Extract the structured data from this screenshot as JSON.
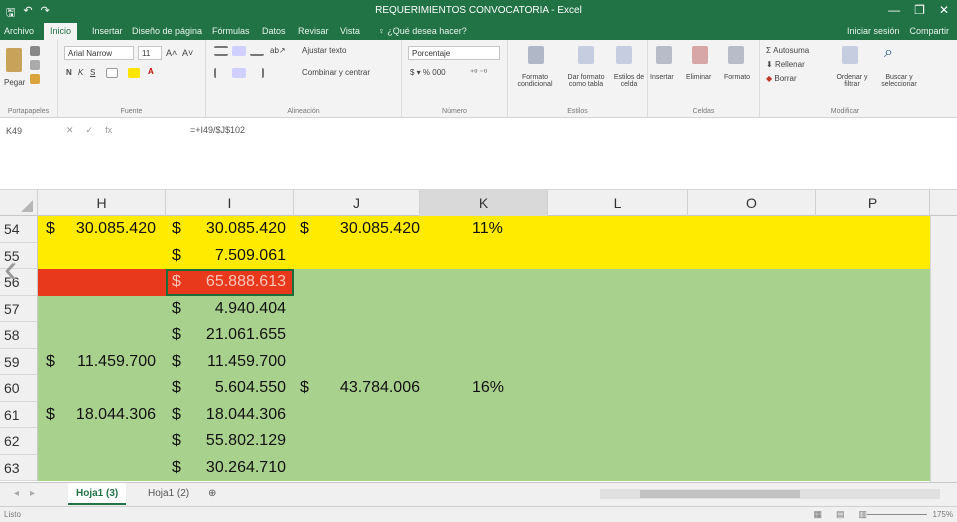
{
  "window": {
    "title": "REQUERIMIENTOS CONVOCATORIA - Excel",
    "minimize": "—",
    "restore": "❐",
    "close": "✕"
  },
  "ribbon_tabs": [
    "Archivo",
    "Inicio",
    "Insertar",
    "Diseño de página",
    "Fórmulas",
    "Datos",
    "Revisar",
    "Vista",
    "♀ ¿Qué desea hacer?"
  ],
  "ribbon_right": {
    "signin": "Iniciar sesión",
    "share": "Compartir"
  },
  "ribbon": {
    "clipboard": {
      "paste": "Pegar",
      "label": "Portapapeles"
    },
    "font": {
      "name": "Arial Narrow",
      "size": "11",
      "bold": "N",
      "italic": "K",
      "underline": "S",
      "label": "Fuente"
    },
    "alignment": {
      "wrap": "Ajustar texto",
      "merge": "Combinar y centrar",
      "label": "Alineación"
    },
    "number": {
      "format": "Porcentaje",
      "label": "Número"
    },
    "styles": {
      "conditional": "Formato condicional",
      "table": "Dar formato como tabla",
      "cell": "Estilos de celda",
      "label": "Estilos"
    },
    "cells": {
      "insert": "Insertar",
      "delete": "Eliminar",
      "format": "Formato",
      "label": "Celdas"
    },
    "editing": {
      "autosum": "Autosuma",
      "fill": "Rellenar",
      "clear": "Borrar",
      "sort": "Ordenar y filtrar",
      "find": "Buscar y seleccionar",
      "label": "Modificar"
    }
  },
  "formula_bar": {
    "name_box": "K49",
    "formula": "=+I49/$J$102"
  },
  "columns": [
    "H",
    "I",
    "J",
    "K",
    "L",
    "O",
    "P"
  ],
  "rows": [
    {
      "num": "54",
      "h_sym": "$",
      "h": "30.085.420",
      "i_sym": "$",
      "i": "30.085.420",
      "j_sym": "$",
      "j": "30.085.420",
      "k": "11%"
    },
    {
      "num": "55",
      "h_sym": "",
      "h": "",
      "i_sym": "$",
      "i": "7.509.061",
      "j_sym": "",
      "j": "",
      "k": ""
    },
    {
      "num": "56",
      "h_sym": "",
      "h": "",
      "i_sym": "$",
      "i": "65.888.613",
      "j_sym": "",
      "j": "",
      "k": ""
    },
    {
      "num": "57",
      "h_sym": "",
      "h": "",
      "i_sym": "$",
      "i": "4.940.404",
      "j_sym": "",
      "j": "",
      "k": ""
    },
    {
      "num": "58",
      "h_sym": "",
      "h": "",
      "i_sym": "$",
      "i": "21.061.655",
      "j_sym": "",
      "j": "",
      "k": ""
    },
    {
      "num": "59",
      "h_sym": "$",
      "h": "11.459.700",
      "i_sym": "$",
      "i": "11.459.700",
      "j_sym": "",
      "j": "",
      "k": ""
    },
    {
      "num": "60",
      "h_sym": "",
      "h": "",
      "i_sym": "$",
      "i": "5.604.550",
      "j_sym": "$",
      "j": "43.784.006",
      "k": "16%"
    },
    {
      "num": "61",
      "h_sym": "$",
      "h": "18.044.306",
      "i_sym": "$",
      "i": "18.044.306",
      "j_sym": "",
      "j": "",
      "k": ""
    },
    {
      "num": "62",
      "h_sym": "",
      "h": "",
      "i_sym": "$",
      "i": "55.802.129",
      "j_sym": "",
      "j": "",
      "k": ""
    },
    {
      "num": "63",
      "h_sym": "",
      "h": "",
      "i_sym": "$",
      "i": "30.264.710",
      "j_sym": "",
      "j": "",
      "k": ""
    }
  ],
  "sheet_tabs": [
    "Hoja1 (3)",
    "Hoja1 (2)"
  ],
  "add_sheet": "⊕",
  "status": {
    "ready": "Listo",
    "zoom": "175%"
  },
  "colors": {
    "excel_green": "#217346",
    "fill_yellow": "#ffeb00",
    "fill_green": "#a9d18e",
    "fill_red": "#e8391c"
  }
}
